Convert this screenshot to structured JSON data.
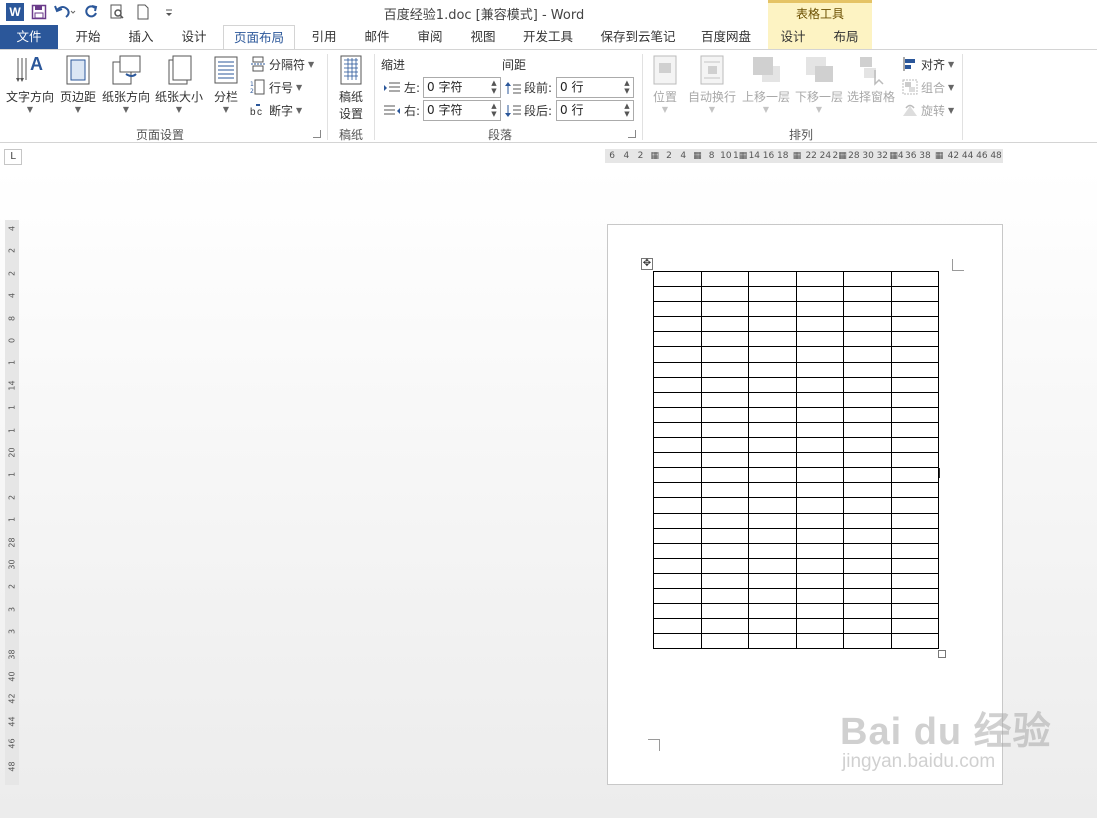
{
  "window": {
    "title": "百度经验1.doc [兼容模式] - Word",
    "context_header": "表格工具",
    "colors": {
      "accent": "#2b579a",
      "context": "#fdf3c3"
    }
  },
  "quick_access": [
    "word-logo",
    "save-icon",
    "undo-icon",
    "redo-icon",
    "print-preview-icon",
    "new-document-icon",
    "customize-icon"
  ],
  "word_logo_text": "W",
  "tabs": [
    "文件",
    "开始",
    "插入",
    "设计",
    "页面布局",
    "引用",
    "邮件",
    "审阅",
    "视图",
    "开发工具",
    "保存到云笔记",
    "百度网盘",
    "设计",
    "布局"
  ],
  "active_tab": "页面布局",
  "ribbon": {
    "page_setup": {
      "label": "页面设置",
      "text_direction": "文字方向",
      "margins": "页边距",
      "orientation": "纸张方向",
      "size": "纸张大小",
      "columns": "分栏",
      "breaks": "分隔符",
      "line_numbers": "行号",
      "hyphenation": "断字"
    },
    "manuscript": {
      "label": "稿纸",
      "button_line1": "稿纸",
      "button_line2": "设置"
    },
    "paragraph": {
      "label": "段落",
      "indent_head": "缩进",
      "spacing_head": "间距",
      "left_label": "左:",
      "right_label": "右:",
      "left_value": "0 字符",
      "right_value": "0 字符",
      "before_label": "段前:",
      "after_label": "段后:",
      "before_value": "0 行",
      "after_value": "0 行"
    },
    "arrange": {
      "label": "排列",
      "position": "位置",
      "wrap_text": "自动换行",
      "bring_forward": "上移一层",
      "send_backward": "下移一层",
      "selection_pane": "选择窗格",
      "align": "对齐",
      "group": "组合",
      "rotate": "旋转"
    }
  },
  "ruler": {
    "tab_selector": "L",
    "horizontal_ticks": [
      "6",
      "4",
      "2",
      "▦",
      "2",
      "4",
      "▦",
      "8",
      "10",
      "1▦",
      "14",
      "16",
      "18",
      "▦",
      "22",
      "24",
      "2▦",
      "28",
      "30",
      "32",
      "▦4",
      "36",
      "38",
      "▦",
      "42",
      "44",
      "46",
      "48"
    ],
    "vertical_ticks": [
      "4",
      "2",
      "2",
      "4",
      "8",
      "0",
      "1",
      "14",
      "1",
      "1",
      "20",
      "1",
      "2",
      "1",
      "28",
      "30",
      "2",
      "3",
      "3",
      "38",
      "40",
      "42",
      "44",
      "46",
      "48"
    ]
  },
  "document": {
    "table_rows": 25,
    "table_cols": 6
  },
  "watermark": {
    "main": "Bai du 经验",
    "sub": "jingyan.baidu.com"
  }
}
